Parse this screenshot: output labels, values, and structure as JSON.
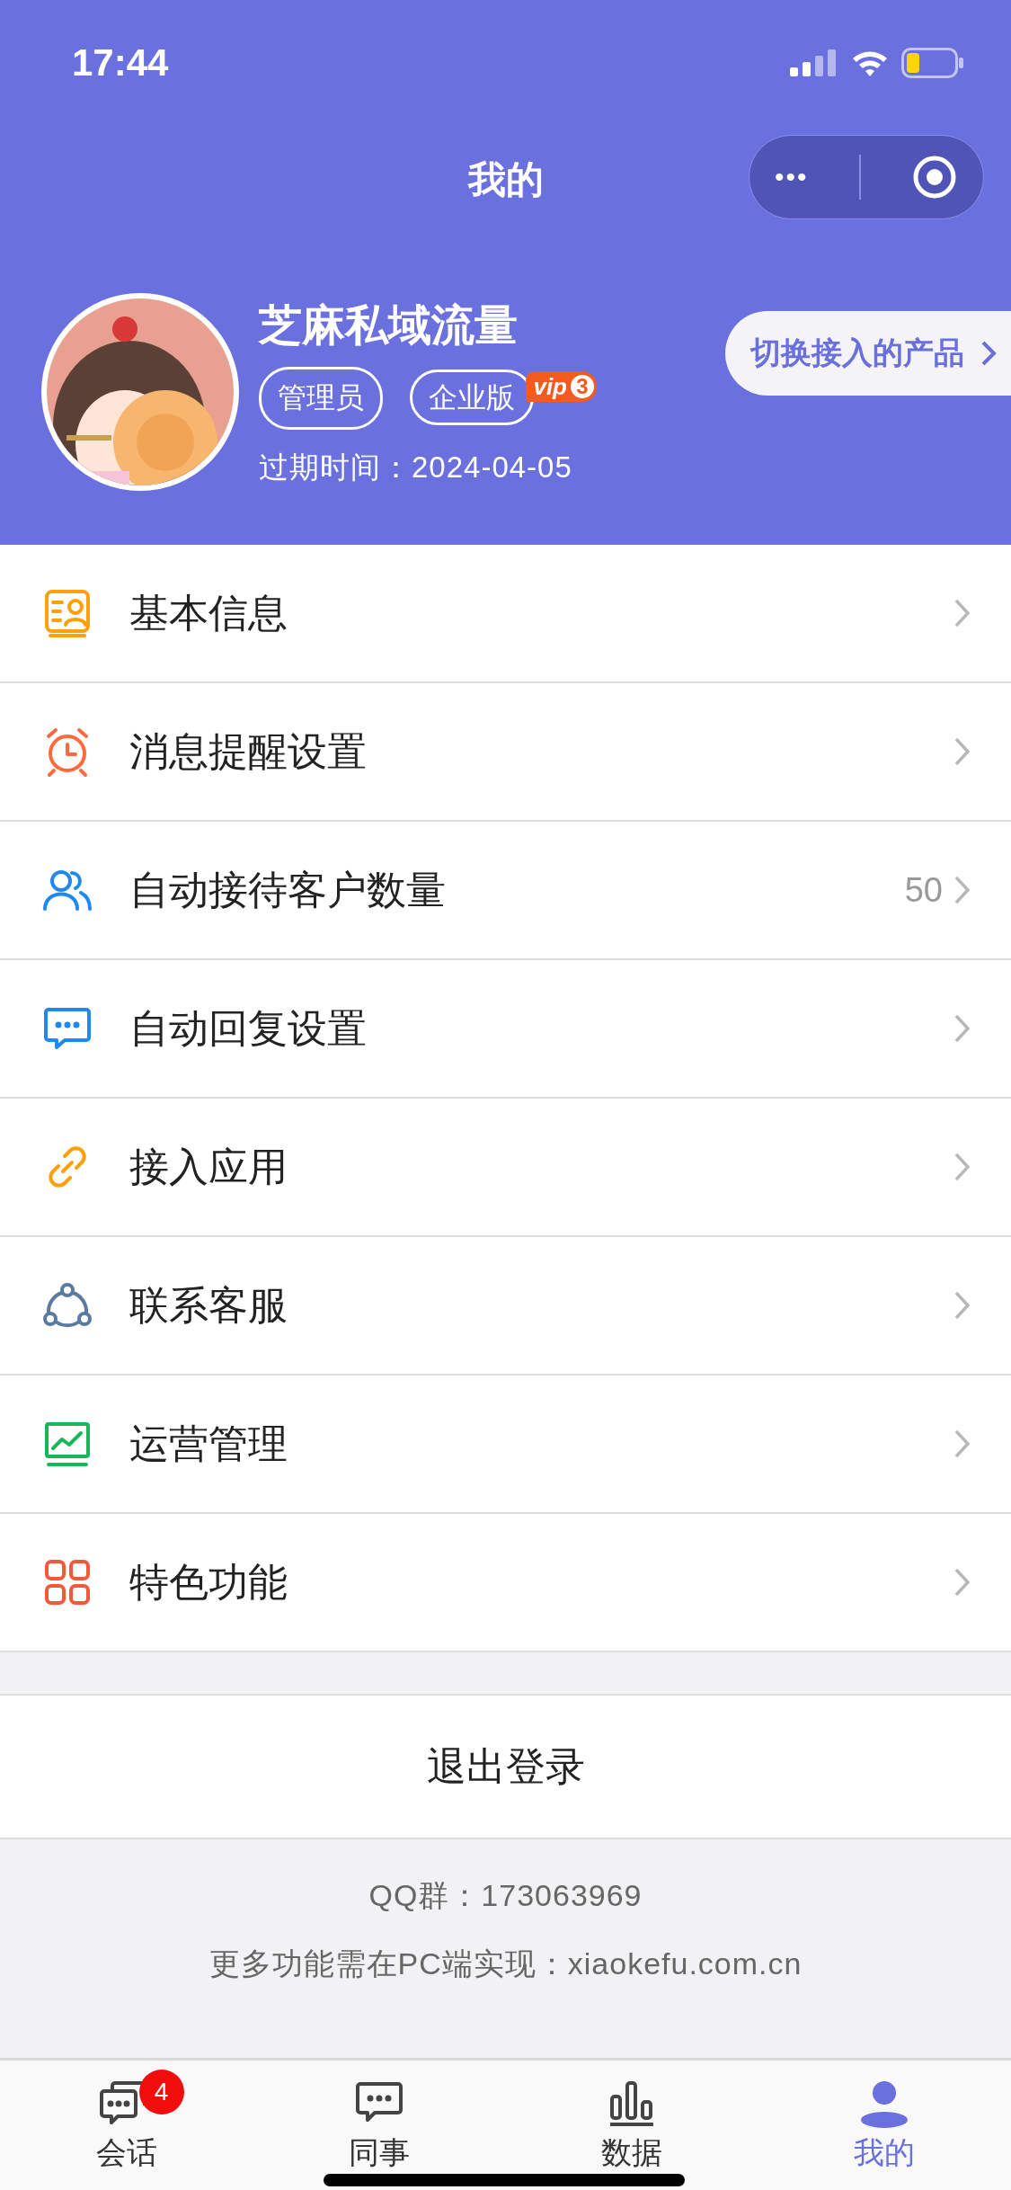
{
  "status_bar": {
    "time": "17:44"
  },
  "nav": {
    "title": "我的",
    "more_button": "•••"
  },
  "profile": {
    "name": "芝麻私域流量",
    "role_tag": "管理员",
    "edition_tag": "企业版",
    "vip_badge": "vip",
    "vip_level": "3",
    "expiry": "过期时间：2024-04-05",
    "switch_button": "切换接入的产品"
  },
  "menu": [
    {
      "label": "基本信息",
      "kind": "profile-card",
      "color": "#ff9f0a"
    },
    {
      "label": "消息提醒设置",
      "kind": "alarm",
      "color": "#ff6a3d"
    },
    {
      "label": "自动接待客户数量",
      "kind": "users",
      "color": "#1e88f5",
      "value": "50"
    },
    {
      "label": "自动回复设置",
      "kind": "chat",
      "color": "#1e88f5"
    },
    {
      "label": "接入应用",
      "kind": "link",
      "color": "#ff9f0a"
    },
    {
      "label": "联系客服",
      "kind": "nodes",
      "color": "#5b7aa0"
    },
    {
      "label": "运营管理",
      "kind": "chart",
      "color": "#18b85a"
    },
    {
      "label": "特色功能",
      "kind": "grid",
      "color": "#f05a3a"
    }
  ],
  "logout_button": "退出登录",
  "footer": {
    "qq_group": "QQ群：173063969",
    "note": "更多功能需在PC端实现：xiaokefu.com.cn"
  },
  "tabs": [
    {
      "label": "会话",
      "kind": "chats",
      "selected": false,
      "badge": "4"
    },
    {
      "label": "同事",
      "kind": "chat",
      "selected": false
    },
    {
      "label": "数据",
      "kind": "bars",
      "selected": false
    },
    {
      "label": "我的",
      "kind": "person",
      "selected": true
    }
  ]
}
